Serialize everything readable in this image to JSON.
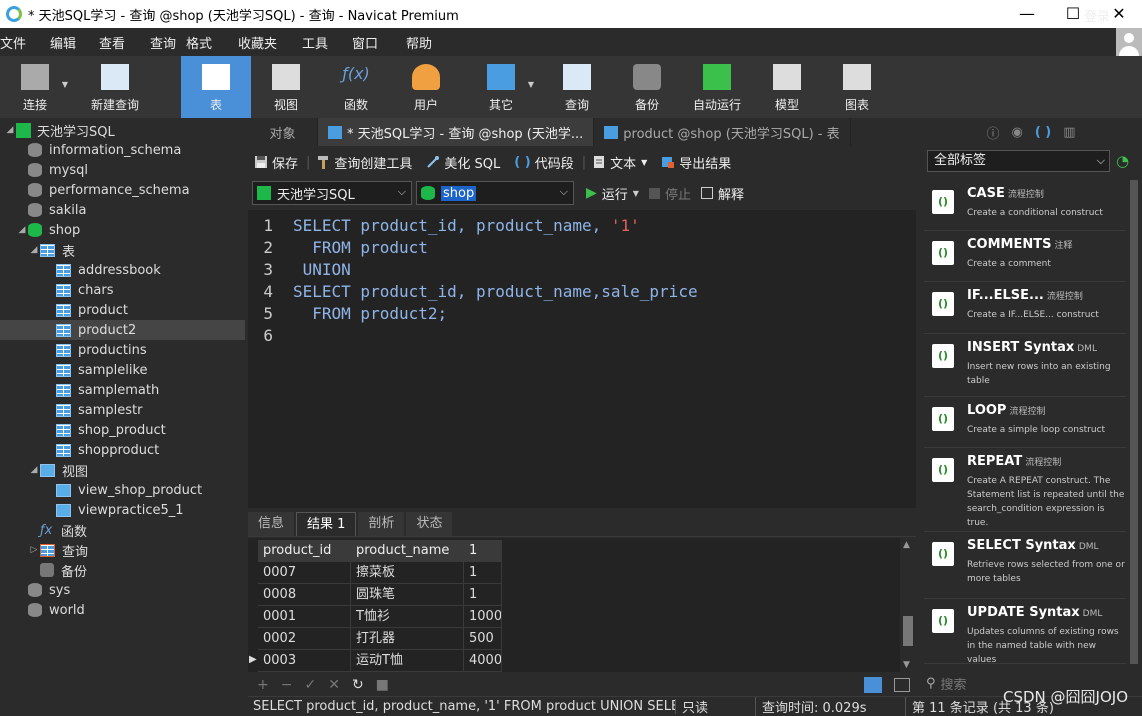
{
  "window": {
    "title": "* 天池SQL学习 - 查询 @shop (天池学习SQL) - 查询 - Navicat Premium",
    "minimize": "—",
    "maximize": "☐",
    "close": "✕"
  },
  "menu": [
    "文件",
    "编辑",
    "查看",
    "查询",
    "格式",
    "收藏夹",
    "工具",
    "窗口",
    "帮助"
  ],
  "login": "登录",
  "toolbar": [
    {
      "label": "连接",
      "icon": "plug-icon",
      "dropdown": true
    },
    {
      "label": "新建查询",
      "icon": "new-query-icon"
    },
    {
      "label": "表",
      "icon": "table-icon",
      "active": true
    },
    {
      "label": "视图",
      "icon": "view-icon"
    },
    {
      "label": "函数",
      "icon": "function-icon"
    },
    {
      "label": "用户",
      "icon": "user-icon"
    },
    {
      "label": "其它",
      "icon": "tools-icon",
      "dropdown": true
    },
    {
      "label": "查询",
      "icon": "query-icon"
    },
    {
      "label": "备份",
      "icon": "backup-icon"
    },
    {
      "label": "自动运行",
      "icon": "autorun-icon"
    },
    {
      "label": "模型",
      "icon": "model-icon"
    },
    {
      "label": "图表",
      "icon": "chart-icon"
    }
  ],
  "tree": [
    {
      "label": "天池学习SQL",
      "type": "conn",
      "indent": 0,
      "arrow": "◢"
    },
    {
      "label": "information_schema",
      "type": "db",
      "indent": 1
    },
    {
      "label": "mysql",
      "type": "db",
      "indent": 1
    },
    {
      "label": "performance_schema",
      "type": "db",
      "indent": 1
    },
    {
      "label": "sakila",
      "type": "db",
      "indent": 1
    },
    {
      "label": "shop",
      "type": "dbopen",
      "indent": 1,
      "arrow": "◢"
    },
    {
      "label": "表",
      "type": "folder",
      "indent": 2,
      "arrow": "◢"
    },
    {
      "label": "addressbook",
      "type": "table",
      "indent": 3
    },
    {
      "label": "chars",
      "type": "table",
      "indent": 3
    },
    {
      "label": "product",
      "type": "table",
      "indent": 3
    },
    {
      "label": "product2",
      "type": "table",
      "indent": 3,
      "selected": true
    },
    {
      "label": "productins",
      "type": "table",
      "indent": 3
    },
    {
      "label": "samplelike",
      "type": "table",
      "indent": 3
    },
    {
      "label": "samplemath",
      "type": "table",
      "indent": 3
    },
    {
      "label": "samplestr",
      "type": "table",
      "indent": 3
    },
    {
      "label": "shop_product",
      "type": "table",
      "indent": 3
    },
    {
      "label": "shopproduct",
      "type": "table",
      "indent": 3
    },
    {
      "label": "视图",
      "type": "viewfolder",
      "indent": 2,
      "arrow": "◢"
    },
    {
      "label": "view_shop_product",
      "type": "view",
      "indent": 3
    },
    {
      "label": "viewpractice5_1",
      "type": "view",
      "indent": 3
    },
    {
      "label": "函数",
      "type": "func",
      "indent": 2
    },
    {
      "label": "查询",
      "type": "queryfolder",
      "indent": 2,
      "arrow": "▷"
    },
    {
      "label": "备份",
      "type": "backup",
      "indent": 2
    },
    {
      "label": "sys",
      "type": "db",
      "indent": 1
    },
    {
      "label": "world",
      "type": "db",
      "indent": 1
    }
  ],
  "tabs": [
    {
      "label": "对象",
      "active": false
    },
    {
      "label": "* 天池SQL学习 - 查询 @shop (天池学...",
      "active": true
    },
    {
      "label": "product @shop (天池学习SQL) - 表",
      "active": false
    }
  ],
  "query_toolbar": [
    "保存",
    "查询创建工具",
    "美化 SQL",
    "代码段",
    "文本",
    "导出结果"
  ],
  "connection_select": "天池学习SQL",
  "database_select": "shop",
  "run": {
    "run_label": "运行",
    "stop_label": "停止",
    "explain_label": "解释"
  },
  "code_lines": [
    {
      "n": "1",
      "parts": [
        {
          "t": "SELECT product_id, product_name, "
        },
        {
          "t": "'1'",
          "str": true
        }
      ]
    },
    {
      "n": "2",
      "parts": [
        {
          "t": "  FROM product"
        }
      ]
    },
    {
      "n": "3",
      "parts": [
        {
          "t": " UNION"
        }
      ]
    },
    {
      "n": "4",
      "parts": [
        {
          "t": "SELECT product_id, product_name,sale_price"
        }
      ]
    },
    {
      "n": "5",
      "parts": [
        {
          "t": "  FROM product2;"
        }
      ]
    },
    {
      "n": "6",
      "parts": [
        {
          "t": ""
        }
      ]
    }
  ],
  "result_tabs": [
    {
      "label": "信息"
    },
    {
      "label": "结果 1",
      "active": true
    },
    {
      "label": "剖析"
    },
    {
      "label": "状态"
    }
  ],
  "grid": {
    "columns": [
      "product_id",
      "product_name",
      "1"
    ],
    "rows": [
      [
        "0007",
        "擦菜板",
        "1"
      ],
      [
        "0008",
        "圆珠笔",
        "1"
      ],
      [
        "0001",
        "T恤衫",
        "1000"
      ],
      [
        "0002",
        "打孔器",
        "500"
      ],
      [
        "0003",
        "运动T恤",
        "4000"
      ]
    ]
  },
  "status": {
    "sql": "SELECT product_id, product_name, '1'   FROM product  UNION SELECT p",
    "mode": "只读",
    "time": "查询时间: 0.029s",
    "records": "第 11 条记录 (共 13 条)"
  },
  "right_panel": {
    "filter": "全部标签",
    "search_placeholder": "搜索",
    "snippets": [
      {
        "name": "CASE",
        "tag": "流程控制",
        "desc": "Create a conditional construct"
      },
      {
        "name": "COMMENTS",
        "tag": "注释",
        "desc": "Create a comment"
      },
      {
        "name": "IF...ELSE...",
        "tag": "流程控制",
        "desc": "Create a IF...ELSE... construct"
      },
      {
        "name": "INSERT Syntax",
        "tag": "DML",
        "desc": "Insert new rows into an existing table"
      },
      {
        "name": "LOOP",
        "tag": "流程控制",
        "desc": "Create a simple loop construct"
      },
      {
        "name": "REPEAT",
        "tag": "流程控制",
        "desc": "Create A REPEAT construct. The Statement list is repeated until the search_condition expression is true."
      },
      {
        "name": "SELECT Syntax",
        "tag": "DML",
        "desc": "Retrieve rows selected from one or more tables"
      },
      {
        "name": "UPDATE Syntax",
        "tag": "DML",
        "desc": "Updates columns of existing rows in the named table with new values"
      }
    ]
  },
  "watermark": "CSDN @囧囧JOJO"
}
